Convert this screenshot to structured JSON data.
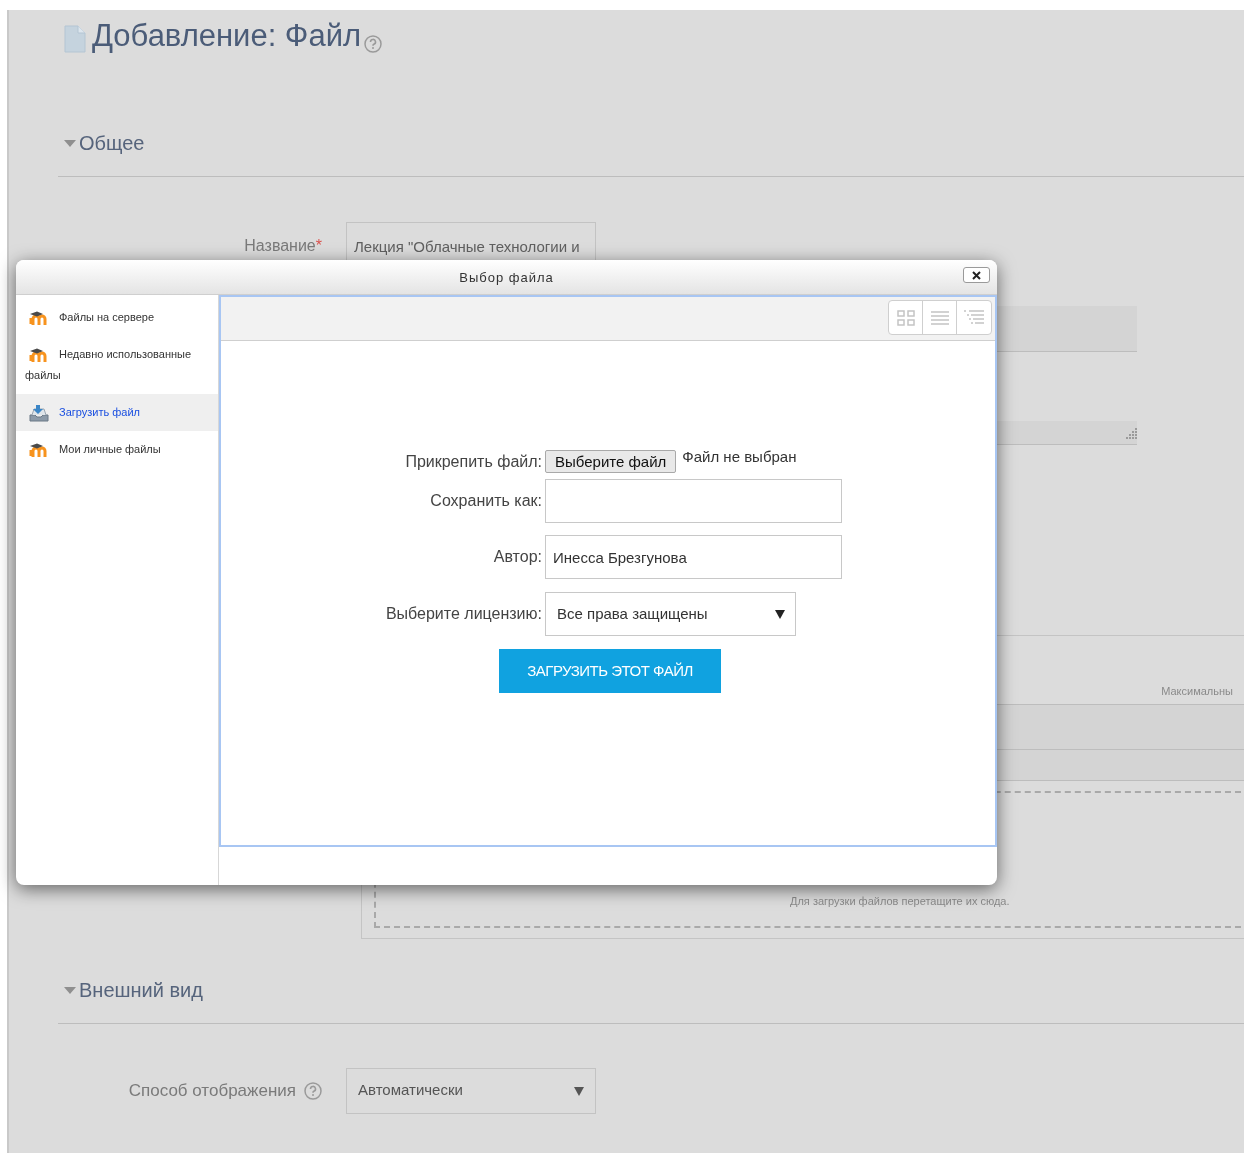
{
  "page": {
    "title": "Добавление: Файл"
  },
  "general_section": {
    "title": "Общее",
    "expanded": true,
    "name_label": "Название",
    "name_required_mark": "*",
    "name_value": "Лекция \"Облачные технологии и",
    "max_size_label": "Максимальны",
    "drop_hint": "Для загрузки файлов перетащите их сюда."
  },
  "appearance_section": {
    "title": "Внешний вид",
    "expanded": true,
    "display_label": "Способ отображения",
    "display_value": "Автоматически"
  },
  "dialog": {
    "title": "Выбор файла",
    "repositories": [
      {
        "label": "Файлы на сервере",
        "kind": "moodle",
        "selected": false
      },
      {
        "label": "Недавно использованные файлы",
        "kind": "moodle",
        "selected": false
      },
      {
        "label": "Загрузить файл",
        "kind": "upload",
        "selected": true
      },
      {
        "label": "Мои личные файлы",
        "kind": "moodle",
        "selected": false
      }
    ],
    "form": {
      "attach_label": "Прикрепить файл:",
      "choose_button": "Выберите файл",
      "no_file": "Файл не выбран",
      "save_as_label": "Сохранить как:",
      "author_label": "Автор:",
      "author_value": "Инесса Брезгунова",
      "license_label": "Выберите лицензию:",
      "license_value": "Все права защищены",
      "upload_button": "ЗАГРУЗИТЬ ЭТОТ ФАЙЛ"
    }
  }
}
